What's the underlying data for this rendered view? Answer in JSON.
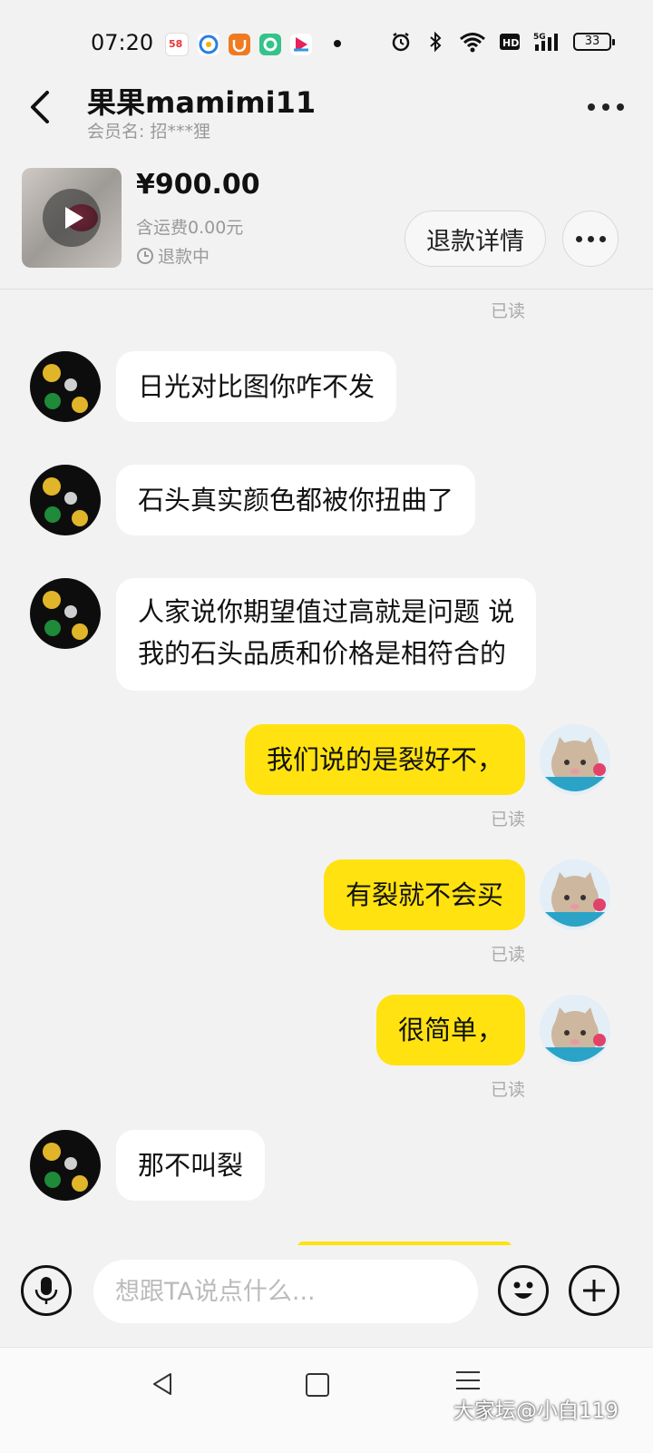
{
  "status_bar": {
    "time": "07:20",
    "battery": "33",
    "app_icons": [
      "58-app-icon",
      "browser-app-icon",
      "uc-app-icon",
      "green-app-icon",
      "video-app-icon"
    ],
    "system_icons": [
      "alarm-icon",
      "bluetooth-icon",
      "wifi-icon",
      "hd-icon",
      "5g-signal-icon",
      "battery-icon"
    ]
  },
  "header": {
    "contact_name": "果果mamimi11",
    "member_label": "会员名:",
    "member_value": "招***狸"
  },
  "order": {
    "price": "¥900.00",
    "shipping": "含运费0.00元",
    "status": "退款中",
    "refund_button": "退款详情"
  },
  "chat": {
    "read_label": "已读",
    "messages": [
      {
        "side": "in",
        "text": "日光对比图你咋不发"
      },
      {
        "side": "in",
        "text": "石头真实颜色都被你扭曲了"
      },
      {
        "side": "in",
        "line1": "人家说你期望值过高就是问题 说",
        "line2": "我的石头品质和价格是相符合的"
      },
      {
        "side": "out",
        "text": "我们说的是裂好不，"
      },
      {
        "side": "out",
        "text": "有裂就不会买"
      },
      {
        "side": "out",
        "text": "很简单，"
      },
      {
        "side": "in",
        "text": "那不叫裂"
      }
    ]
  },
  "input_bar": {
    "placeholder": "想跟TA说点什么..."
  },
  "watermark": "大家坛@小白119",
  "colors": {
    "accent_yellow": "#ffe20f",
    "background": "#f2f2f2"
  }
}
